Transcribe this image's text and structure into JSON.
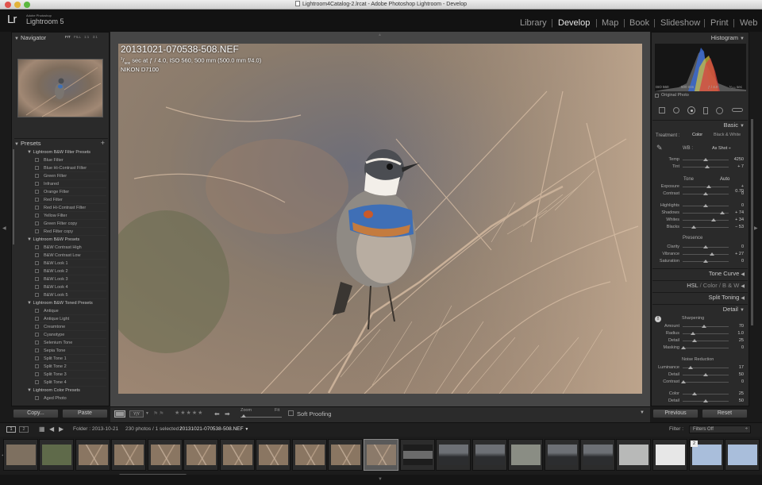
{
  "window": {
    "title": "Lightroom4Catalog-2.lrcat - Adobe Photoshop Lightroom - Develop"
  },
  "brand": {
    "logo": "Lr",
    "sub": "Adobe Photoshop",
    "name": "Lightroom 5"
  },
  "modules": [
    "Library",
    "Develop",
    "Map",
    "Book",
    "Slideshow",
    "Print",
    "Web"
  ],
  "active_module": "Develop",
  "navigator": {
    "title": "Navigator",
    "zooms": [
      "FIT",
      "FILL",
      "1:1",
      "3:1"
    ]
  },
  "presets": {
    "title": "Presets",
    "folders": [
      {
        "name": "Lightroom B&W Filter Presets",
        "items": [
          "Blue Filter",
          "Blue Hi-Contrast Filter",
          "Green Filter",
          "Infrared",
          "Orange Filter",
          "Red Filter",
          "Red Hi-Contrast Filter",
          "Yellow Filter",
          "Green Filter copy",
          "Red Filter copy"
        ]
      },
      {
        "name": "Lightroom B&W Presets",
        "items": [
          "B&W Contrast High",
          "B&W Contrast Low",
          "B&W Look 1",
          "B&W Look 2",
          "B&W Look 3",
          "B&W Look 4",
          "B&W Look 5"
        ]
      },
      {
        "name": "Lightroom B&W Toned Presets",
        "items": [
          "Antique",
          "Antique Light",
          "Creamtone",
          "Cyanotype",
          "Selenium Tone",
          "Sepia Tone",
          "Split Tone 1",
          "Split Tone 2",
          "Split Tone 3",
          "Split Tone 4"
        ]
      },
      {
        "name": "Lightroom Color Presets",
        "items": [
          "Aged Photo"
        ]
      }
    ]
  },
  "left_buttons": {
    "copy": "Copy...",
    "paste": "Paste"
  },
  "photo_info": {
    "filename": "20131021-070538-508.NEF",
    "exposure_num": "1",
    "exposure_den": "500",
    "exposure_rest": " sec at ƒ / 4.0, ISO 560, 500 mm (500.0 mm f/4.0)",
    "camera": "NIKON D7100"
  },
  "toolbar": {
    "zoom": "Zoom",
    "fit": "Fit",
    "soft_proofing": "Soft Proofing"
  },
  "histogram": {
    "title": "Histogram",
    "iso": "ISO 560",
    "focal": "500 mm",
    "aperture": "ƒ / 4.0",
    "shutter": "¹⁄₅₀₀ sec",
    "original": "Original Photo"
  },
  "basic": {
    "title": "Basic",
    "treatment_label": "Treatment :",
    "color": "Color",
    "bw": "Black & White",
    "wb_label": "WB :",
    "wb_value": "As Shot",
    "temp": {
      "label": "Temp",
      "value": "4250",
      "pos": 0.5
    },
    "tint": {
      "label": "Tint",
      "value": "+ 7",
      "pos": 0.53
    },
    "tone_label": "Tone",
    "auto": "Auto",
    "tone": [
      {
        "label": "Exposure",
        "value": "+ 0.70",
        "pos": 0.57
      },
      {
        "label": "Contrast",
        "value": "0",
        "pos": 0.5
      }
    ],
    "tone2": [
      {
        "label": "Highlights",
        "value": "0",
        "pos": 0.5
      },
      {
        "label": "Shadows",
        "value": "+ 74",
        "pos": 0.87
      },
      {
        "label": "Whites",
        "value": "+ 34",
        "pos": 0.67
      },
      {
        "label": "Blacks",
        "value": "− 53",
        "pos": 0.24
      }
    ],
    "presence_label": "Presence",
    "presence": [
      {
        "label": "Clarity",
        "value": "0",
        "pos": 0.5
      },
      {
        "label": "Vibrance",
        "value": "+ 27",
        "pos": 0.63
      },
      {
        "label": "Saturation",
        "value": "0",
        "pos": 0.5
      }
    ]
  },
  "sections": {
    "tone_curve": "Tone Curve",
    "hsl": "HSL",
    "color": "Color",
    "bw": "B & W",
    "split": "Split Toning",
    "detail": "Detail"
  },
  "detail": {
    "sharpening_label": "Sharpening",
    "sharpening": [
      {
        "label": "Amount",
        "value": "70",
        "pos": 0.47
      },
      {
        "label": "Radius",
        "value": "1.0",
        "pos": 0.22
      },
      {
        "label": "Detail",
        "value": "25",
        "pos": 0.25
      },
      {
        "label": "Masking",
        "value": "0",
        "pos": 0.02
      }
    ],
    "noise_label": "Noise Reduction",
    "noise": [
      {
        "label": "Luminance",
        "value": "17",
        "pos": 0.17
      },
      {
        "label": "Detail",
        "value": "50",
        "pos": 0.5
      },
      {
        "label": "Contrast",
        "value": "0",
        "pos": 0.02
      }
    ],
    "color": [
      {
        "label": "Color",
        "value": "25",
        "pos": 0.25
      },
      {
        "label": "Detail",
        "value": "50",
        "pos": 0.5
      }
    ]
  },
  "right_buttons": {
    "previous": "Previous",
    "reset": "Reset"
  },
  "filmstrip_bar": {
    "pages": [
      "1",
      "2"
    ],
    "folder": "Folder : 2013-10-21",
    "count": "230 photos / 1 selected /",
    "selected": "20131021-070538-508.NEF",
    "filter_label": "Filter :",
    "filter_value": "Filters Off"
  },
  "filmstrip_badge": "2"
}
